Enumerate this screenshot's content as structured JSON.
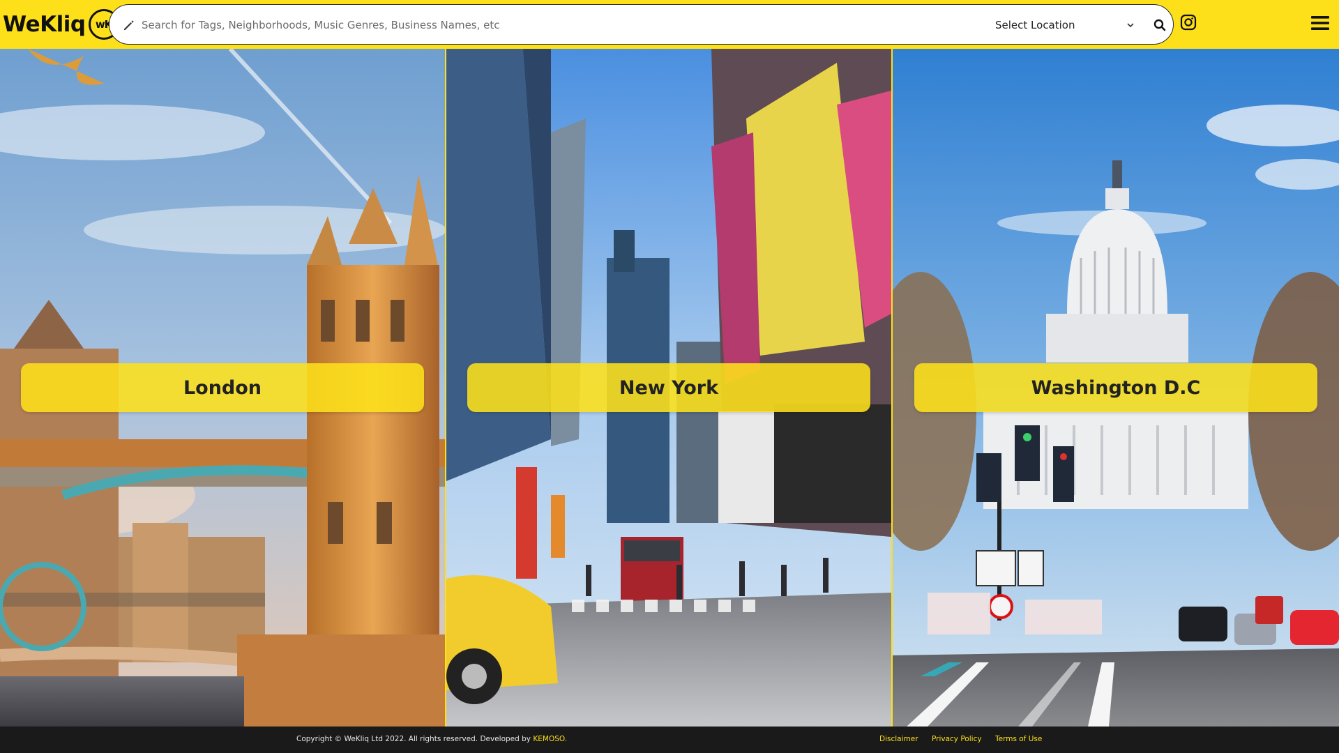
{
  "header": {
    "logo_text": "WeKliq",
    "logo_badge": "wK",
    "search": {
      "placeholder": "Search for Tags, Neighborhoods, Music Genres, Business Names, etc",
      "value": ""
    },
    "location_select": {
      "label": "Select Location"
    },
    "icons": [
      "pencil-icon",
      "search-icon",
      "instagram-icon",
      "menu-icon",
      "chevron-down-icon"
    ]
  },
  "cities": [
    {
      "name": "London"
    },
    {
      "name": "New York"
    },
    {
      "name": "Washington D.C"
    }
  ],
  "footer": {
    "copyright": "Copyright © WeKliq Ltd 2022. All rights reserved. Developed by",
    "developer": "KEMOSO.",
    "links": [
      {
        "label": "Disclaimer"
      },
      {
        "label": "Privacy Policy"
      },
      {
        "label": "Terms of Use"
      }
    ]
  },
  "colors": {
    "brand_yellow": "#fde01a",
    "footer_bg": "#1a1a1a",
    "text_dark": "#222222"
  }
}
